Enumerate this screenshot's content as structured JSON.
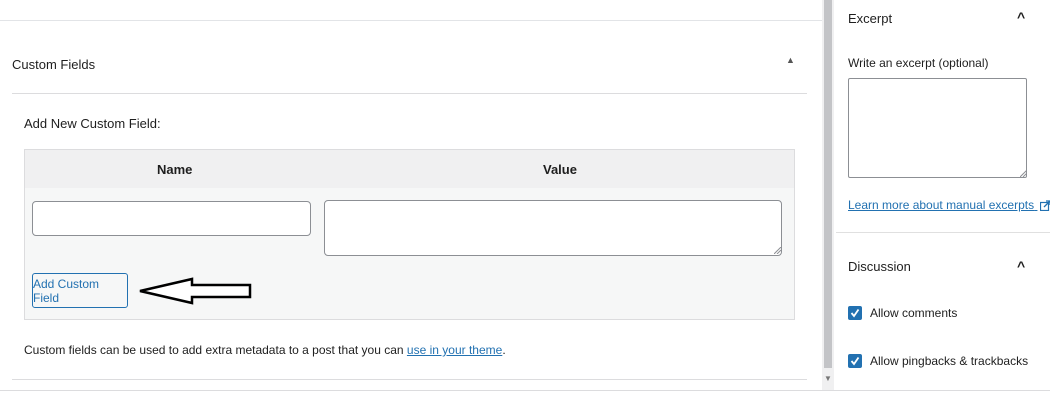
{
  "custom_fields": {
    "title": "Custom Fields",
    "add_new_label": "Add New Custom Field:",
    "columns": {
      "name": "Name",
      "value": "Value"
    },
    "name_input_value": "",
    "value_input_value": "",
    "add_button_label": "Add Custom Field",
    "help_text": "Custom fields can be used to add extra metadata to a post that you can",
    "help_link": "use in your theme",
    "help_suffix": "."
  },
  "excerpt": {
    "title": "Excerpt",
    "input_label": "Write an excerpt (optional)",
    "input_value": "",
    "learn_more_link": "Learn more about manual excerpts"
  },
  "discussion": {
    "title": "Discussion",
    "options": [
      {
        "label": "Allow comments",
        "checked": true
      },
      {
        "label": "Allow pingbacks & trackbacks",
        "checked": true
      }
    ]
  },
  "colors": {
    "accent": "#2271b1",
    "border": "#dcdcde"
  }
}
